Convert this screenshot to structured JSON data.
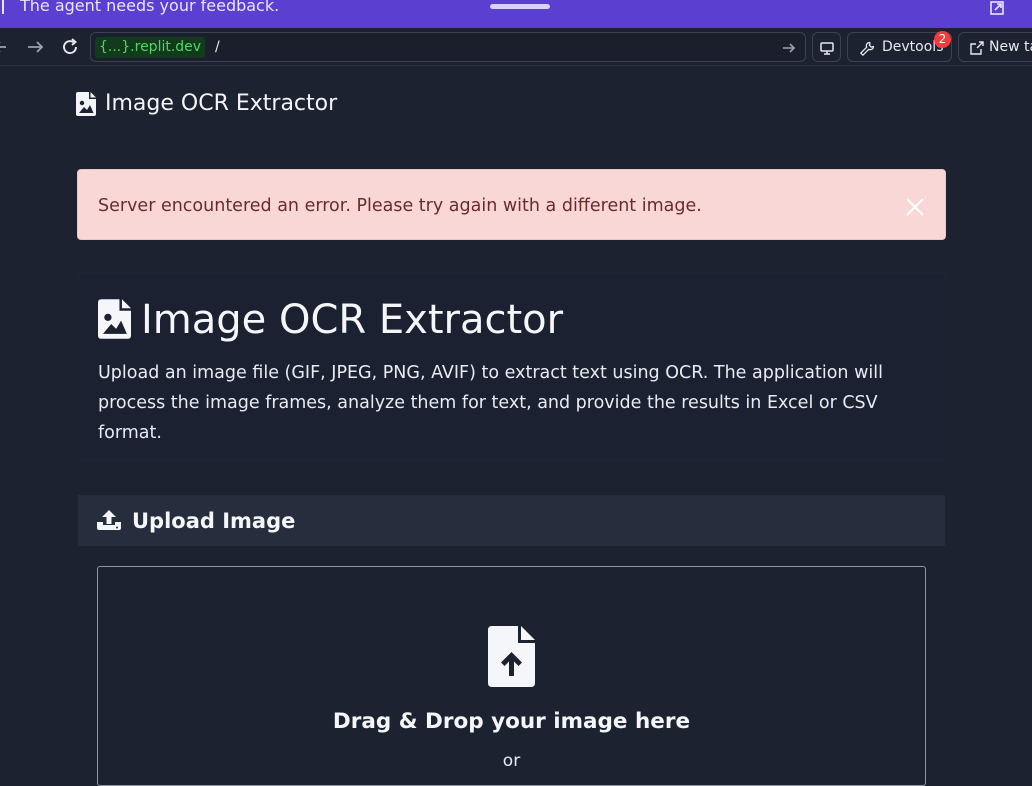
{
  "feedback_bar": {
    "message": "The agent needs your feedback."
  },
  "browser": {
    "url_domain_prefix": "{...}",
    "url_domain_suffix": ".replit.dev",
    "url_path": "/",
    "devtools_label": "Devtools",
    "devtools_badge": "2",
    "new_tab_label": "New ta"
  },
  "app": {
    "brand": "Image OCR Extractor",
    "alert": {
      "message": "Server encountered an error. Please try again with a different image."
    },
    "hero": {
      "title": "Image OCR Extractor",
      "description": "Upload an image file (GIF, JPEG, PNG, AVIF) to extract text using OCR. The application will process the image frames, analyze them for text, and provide the results in Excel or CSV format."
    },
    "upload": {
      "header": "Upload Image",
      "drop_title": "Drag & Drop your image here",
      "or_text": "or"
    }
  },
  "colors": {
    "feedback_bar": "#5b3fd1",
    "page_background": "#1c2230",
    "alert_background": "#f9d7d7",
    "alert_text": "#6b2a2a",
    "domain_text": "#4fd760",
    "badge": "#f03c3c"
  },
  "icons": [
    "expand-icon",
    "back-icon",
    "forward-icon",
    "reload-icon",
    "go-icon",
    "screen-icon",
    "wrench-icon",
    "external-link-icon",
    "file-image-icon",
    "close-icon",
    "upload-icon",
    "file-upload-icon"
  ]
}
